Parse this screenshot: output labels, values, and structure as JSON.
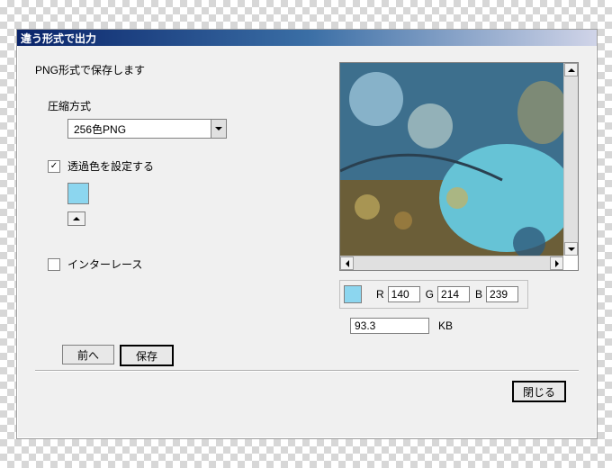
{
  "window": {
    "title": "違う形式で出力"
  },
  "heading": "PNG形式で保存します",
  "compression": {
    "label": "圧縮方式",
    "selected": "256色PNG"
  },
  "transparency": {
    "label": "透過色を設定する",
    "checked": true,
    "color": "#8cd6ef"
  },
  "interlace": {
    "label": "インターレース",
    "checked": false
  },
  "rgb": {
    "r_label": "R",
    "g_label": "G",
    "b_label": "B",
    "r": "140",
    "g": "214",
    "b": "239"
  },
  "filesize": {
    "value": "93.3",
    "unit": "KB"
  },
  "buttons": {
    "back": "前へ",
    "save": "保存",
    "close": "閉じる"
  }
}
